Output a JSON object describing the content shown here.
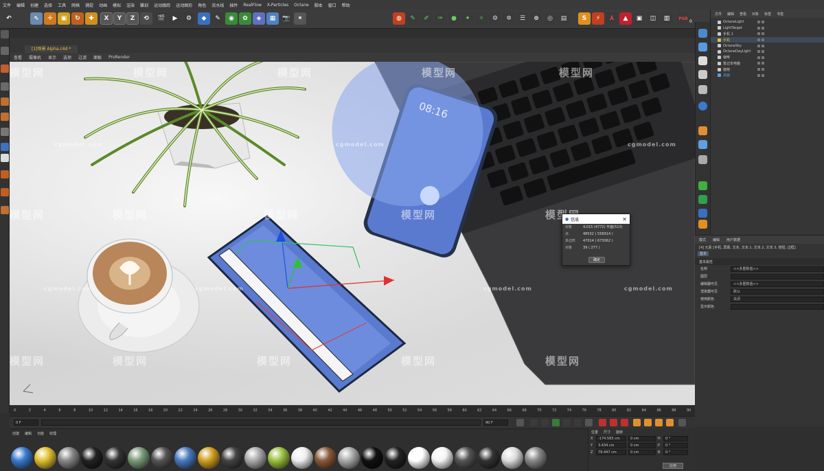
{
  "menubar": [
    "文件",
    "编辑",
    "创建",
    "选择",
    "工具",
    "网格",
    "捕捉",
    "动画",
    "模拟",
    "渲染",
    "雕刻",
    "运动跟踪",
    "运动图形",
    "角色",
    "流水线",
    "插件",
    "RealFlow",
    "X-Particles",
    "Octane",
    "脚本",
    "窗口",
    "帮助"
  ],
  "toolbar": {
    "x": "X",
    "y": "Y",
    "z": "Z",
    "psr": "PSR",
    "psr_value": "0"
  },
  "viewport": {
    "tab_label": "[1]场景 Alpha.c4d *",
    "menu": [
      "查看",
      "摄像机",
      "显示",
      "选项",
      "过滤",
      "面板",
      "ProRender"
    ],
    "watermarks": {
      "brand_cn": "模型网",
      "brand_en": "cgmodel.com"
    },
    "phone_time": "08:16"
  },
  "dialog": {
    "title": "信息",
    "close": "✕",
    "rows": [
      {
        "k": "对象",
        "v": "4,015 (4772) 平面(513)"
      },
      {
        "k": "点",
        "v": "48532 ( 558914 )"
      },
      {
        "k": "多边形",
        "v": "47014 ( 673062 )"
      },
      {
        "k": "对象",
        "v": "39 ( 277 )"
      }
    ],
    "ok": "确定"
  },
  "object_manager": {
    "menu": [
      "文件",
      "编辑",
      "查看",
      "对象",
      "标签",
      "书签"
    ],
    "items": [
      {
        "name": "OctaneLight",
        "color": "#cccccc"
      },
      {
        "name": "LightTarget",
        "color": "#cccccc"
      },
      {
        "name": "手机 1",
        "color": "#cccccc"
      },
      {
        "name": "手机",
        "color": "#e0c040"
      },
      {
        "name": "OctaneSky",
        "color": "#cccccc"
      },
      {
        "name": "OctaneDayLight",
        "color": "#cccccc"
      },
      {
        "name": "咖啡",
        "color": "#cccccc"
      },
      {
        "name": "笔记本电脑",
        "color": "#cccccc"
      },
      {
        "name": "植物",
        "color": "#cccccc"
      },
      {
        "name": "桌面",
        "color": "#5aa0e0"
      }
    ]
  },
  "attributes": {
    "tabs": [
      "模式",
      "编辑",
      "用户数据"
    ],
    "title": "[4] 元素 [手机, 屏幕, 文本, 文本.1, 文本.2, 文本.3, 按钮, 边框]",
    "subtabs": [
      "基本"
    ],
    "section": "基本属性",
    "fields": [
      {
        "label": "名称",
        "value": "<<多重数值>>"
      },
      {
        "label": "图层",
        "value": ""
      },
      {
        "label": "编辑器可见",
        "value": "<<多重数值>>"
      },
      {
        "label": "渲染器可见",
        "value": "默认"
      },
      {
        "label": "使用颜色",
        "value": "关闭"
      },
      {
        "label": "显示颜色",
        "value": ""
      }
    ]
  },
  "timeline": {
    "ticks": [
      "0",
      "2",
      "4",
      "6",
      "8",
      "10",
      "12",
      "14",
      "16",
      "18",
      "20",
      "22",
      "24",
      "26",
      "28",
      "30",
      "32",
      "34",
      "36",
      "38",
      "40",
      "42",
      "44",
      "46",
      "48",
      "50",
      "52",
      "54",
      "56",
      "58",
      "60",
      "62",
      "64",
      "66",
      "68",
      "70",
      "72",
      "74",
      "76",
      "78",
      "80",
      "82",
      "84",
      "86",
      "88",
      "90"
    ],
    "start_field": "0 F",
    "current_field": "0 F",
    "end_field": "90 F",
    "end2_field": "90 F"
  },
  "materials": {
    "menu": [
      "创建",
      "编辑",
      "功能",
      "纹理"
    ]
  },
  "coordinates": {
    "head": [
      "位置",
      "尺寸",
      "旋转"
    ],
    "rows": [
      {
        "ax": "X",
        "pos": "-174.583 cm",
        "size": "0 cm",
        "rot_ax": "H",
        "rot": "0 °"
      },
      {
        "ax": "Y",
        "pos": "3.434 cm",
        "size": "0 cm",
        "rot_ax": "P",
        "rot": "0 °"
      },
      {
        "ax": "Z",
        "pos": "79.447 cm",
        "size": "0 cm",
        "rot_ax": "B",
        "rot": "0 °"
      }
    ],
    "apply": "应用"
  }
}
